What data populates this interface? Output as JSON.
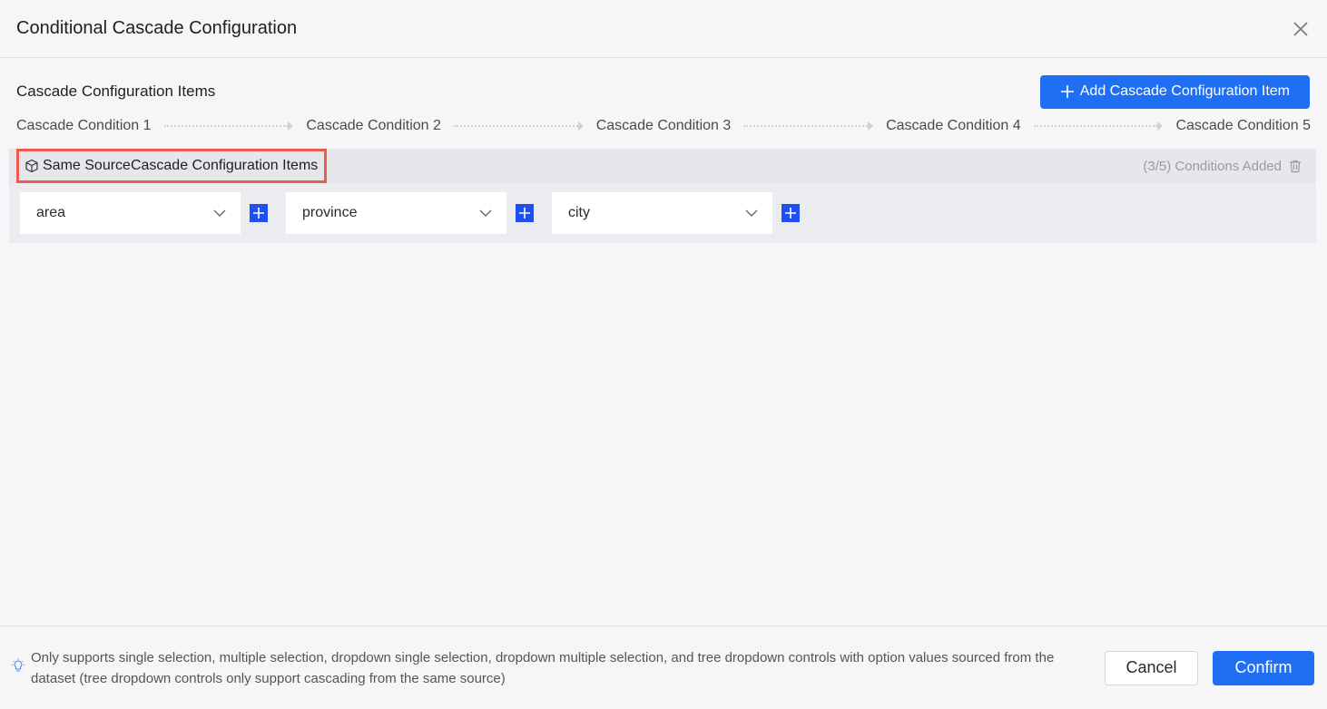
{
  "dialog": {
    "title": "Conditional Cascade Configuration"
  },
  "section": {
    "title": "Cascade Configuration Items",
    "add_button_label": "Add Cascade Configuration Item"
  },
  "steps": [
    "Cascade Condition 1",
    "Cascade Condition 2",
    "Cascade Condition 3",
    "Cascade Condition 4",
    "Cascade Condition 5"
  ],
  "group": {
    "name": "Same SourceCascade Configuration Items",
    "status": "(3/5) Conditions Added",
    "fields": [
      "area",
      "province",
      "city"
    ]
  },
  "footer": {
    "tip": "Only supports single selection, multiple selection, dropdown single selection, dropdown multiple selection, and tree dropdown controls with option values sourced from the dataset (tree dropdown controls only support cascading from the same source)",
    "cancel_label": "Cancel",
    "confirm_label": "Confirm"
  },
  "colors": {
    "primary": "#1f6ff5",
    "highlight_border": "#ec5b4f"
  },
  "icons": {
    "close": "close-icon",
    "add": "plus-icon",
    "group": "cube-icon",
    "delete": "trash-icon",
    "dropdown": "chevron-down-icon",
    "tip": "lightbulb-icon"
  }
}
